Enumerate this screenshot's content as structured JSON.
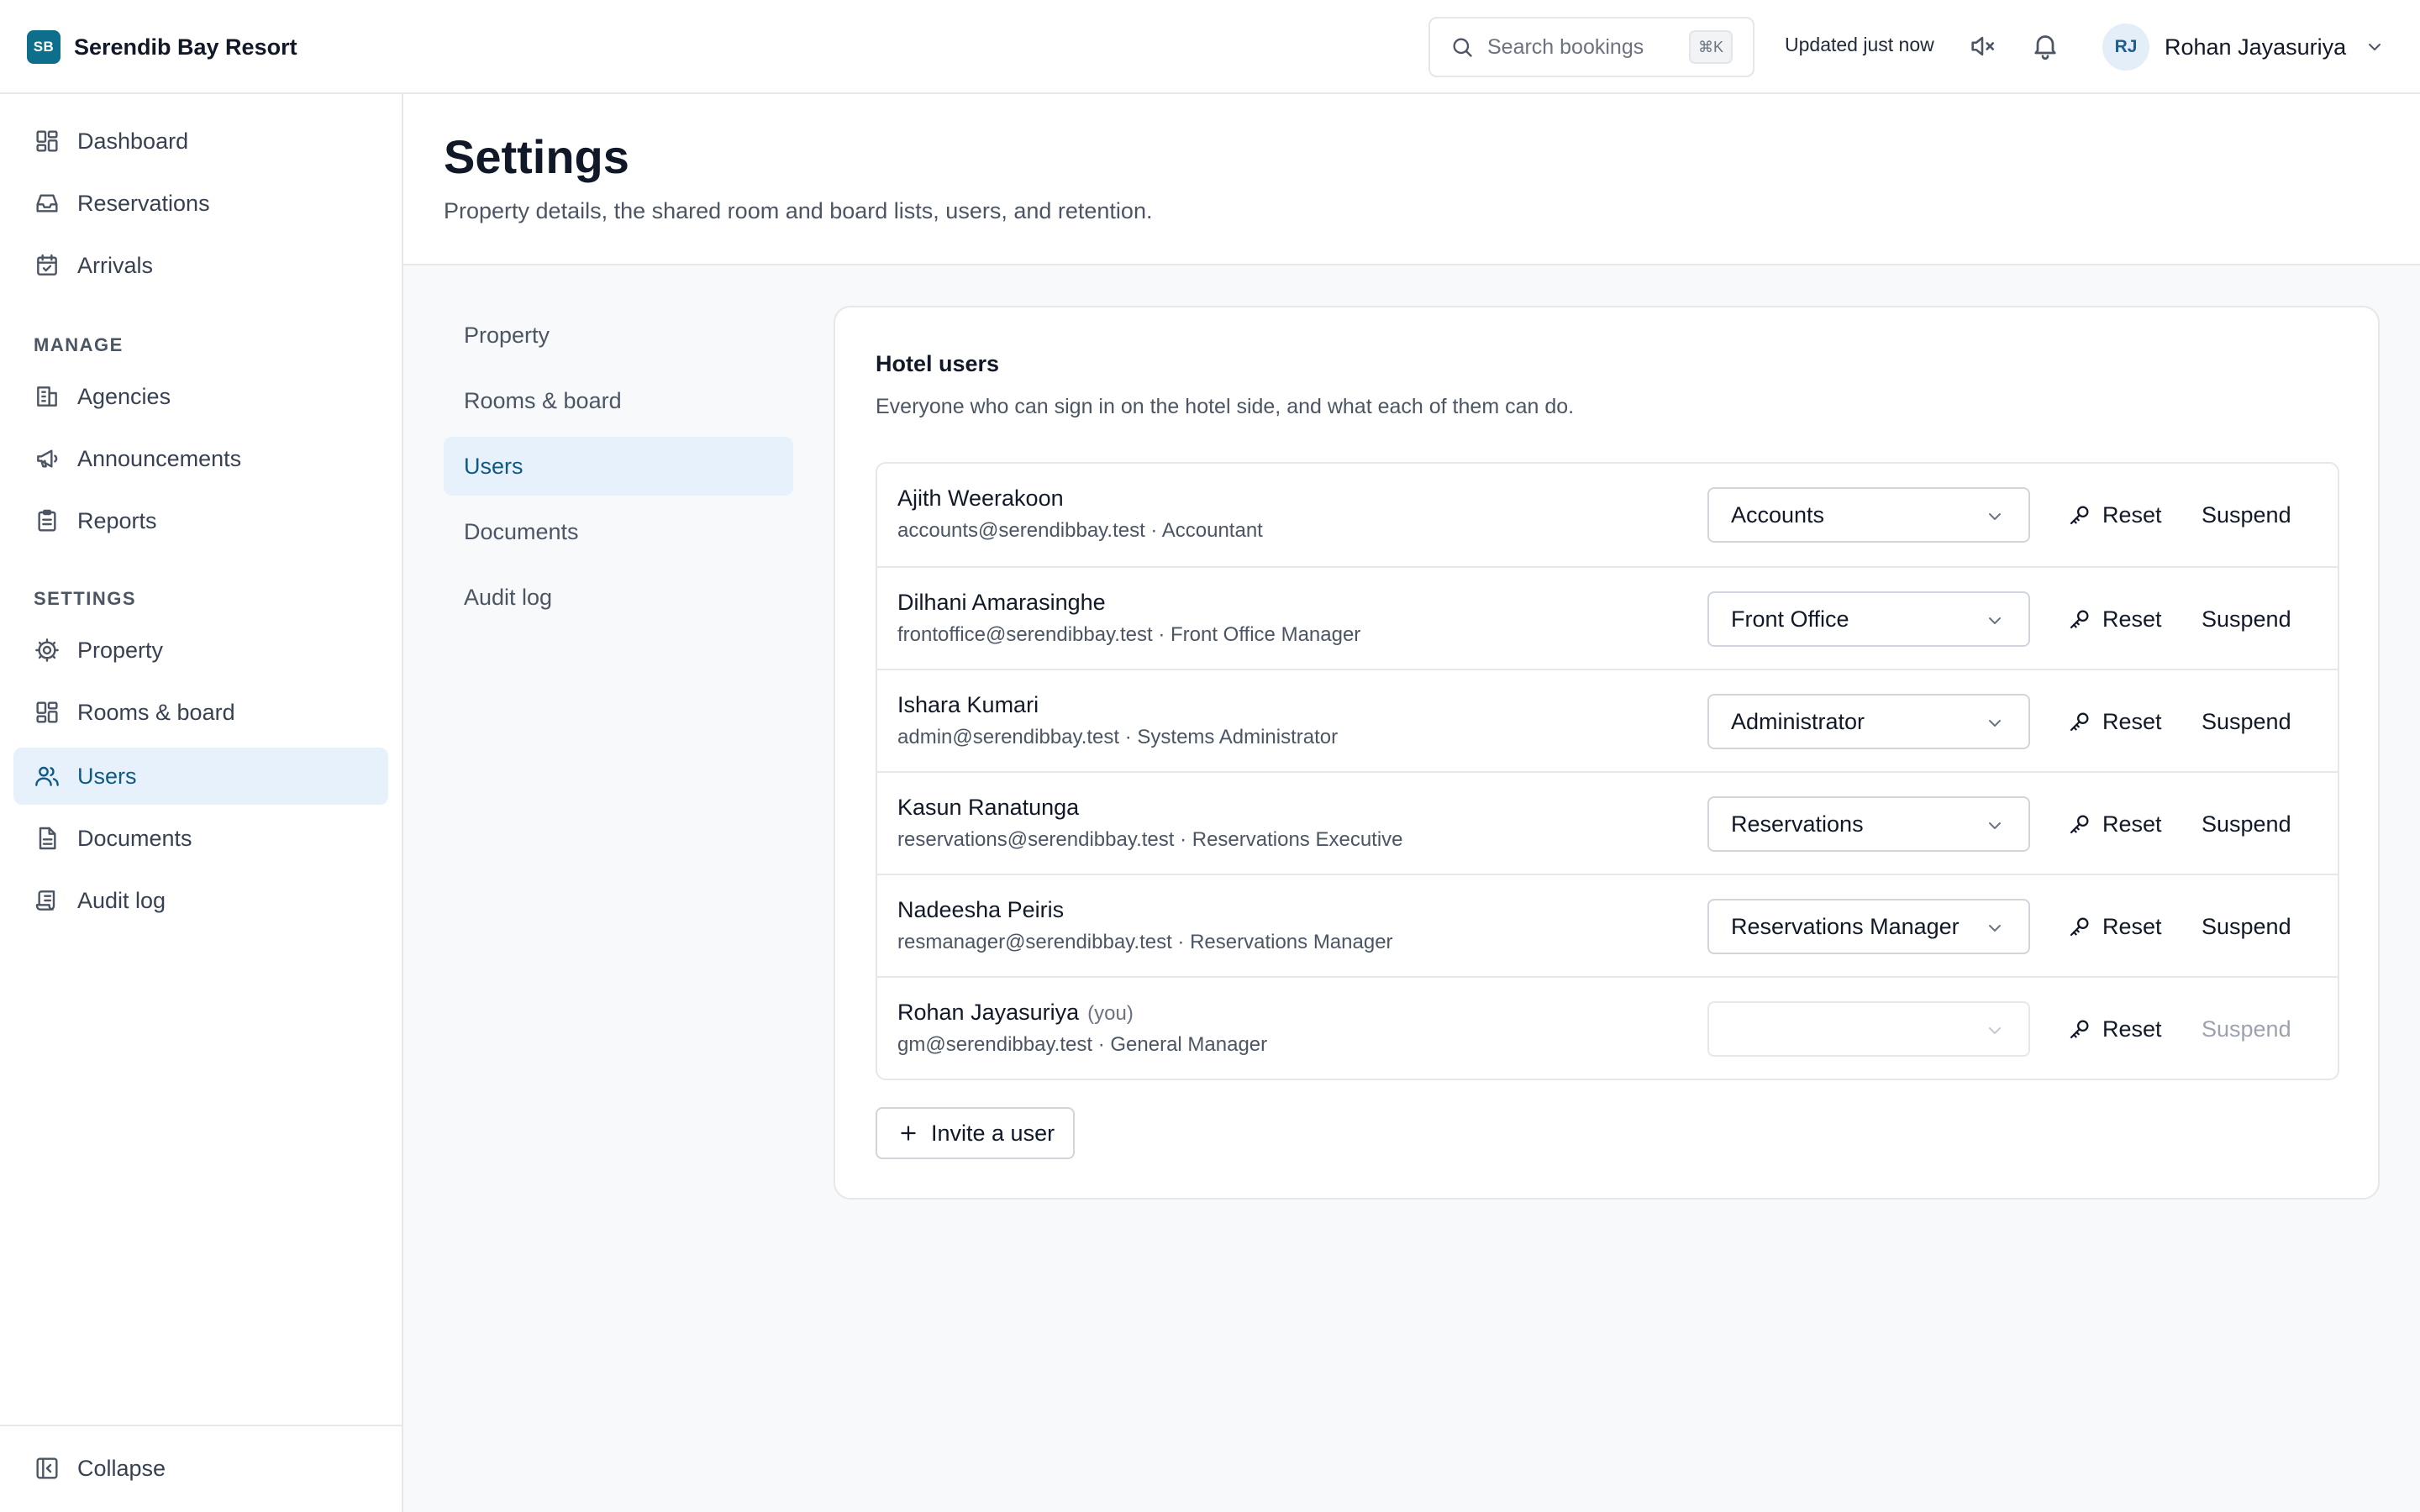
{
  "brand": {
    "logo_text": "SB",
    "name": "Serendib Bay Resort",
    "color": "#0e6f8c"
  },
  "topbar": {
    "search_placeholder": "Search bookings",
    "search_shortcut": "⌘K",
    "updated_text": "Updated just now",
    "user": {
      "initials": "RJ",
      "name": "Rohan Jayasuriya"
    }
  },
  "sidebar": {
    "main_items": [
      {
        "label": "Dashboard",
        "icon": "dashboard-icon"
      },
      {
        "label": "Reservations",
        "icon": "inbox-icon"
      },
      {
        "label": "Arrivals",
        "icon": "calendar-check-icon"
      }
    ],
    "manage_label": "MANAGE",
    "manage_items": [
      {
        "label": "Agencies",
        "icon": "building-icon"
      },
      {
        "label": "Announcements",
        "icon": "megaphone-icon"
      },
      {
        "label": "Reports",
        "icon": "clipboard-icon"
      }
    ],
    "settings_label": "SETTINGS",
    "settings_items": [
      {
        "label": "Property",
        "icon": "gear-icon"
      },
      {
        "label": "Rooms & board",
        "icon": "grid-icon"
      },
      {
        "label": "Users",
        "icon": "users-icon",
        "active": true
      },
      {
        "label": "Documents",
        "icon": "document-icon"
      },
      {
        "label": "Audit log",
        "icon": "scroll-icon"
      }
    ],
    "collapse_label": "Collapse"
  },
  "page": {
    "title": "Settings",
    "subtitle": "Property details, the shared room and board lists, users, and retention."
  },
  "subnav": {
    "items": [
      "Property",
      "Rooms & board",
      "Users",
      "Documents",
      "Audit log"
    ],
    "active": "Users"
  },
  "users_card": {
    "title": "Hotel users",
    "description": "Everyone who can sign in on the hotel side, and what each of them can do.",
    "reset_label": "Reset",
    "suspend_label": "Suspend",
    "you_label": "(you)",
    "invite_label": "Invite a user",
    "users": [
      {
        "name": "Ajith Weerakoon",
        "meta": "accounts@serendibbay.test · Accountant",
        "role": "Accounts"
      },
      {
        "name": "Dilhani Amarasinghe",
        "meta": "frontoffice@serendibbay.test · Front Office Manager",
        "role": "Front Office"
      },
      {
        "name": "Ishara Kumari",
        "meta": "admin@serendibbay.test · Systems Administrator",
        "role": "Administrator"
      },
      {
        "name": "Kasun Ranatunga",
        "meta": "reservations@serendibbay.test · Reservations Executive",
        "role": "Reservations"
      },
      {
        "name": "Nadeesha Peiris",
        "meta": "resmanager@serendibbay.test · Reservations Manager",
        "role": "Reservations Manager"
      },
      {
        "name": "Rohan Jayasuriya",
        "meta": "gm@serendibbay.test · General Manager",
        "role": "",
        "is_you": true
      }
    ]
  }
}
